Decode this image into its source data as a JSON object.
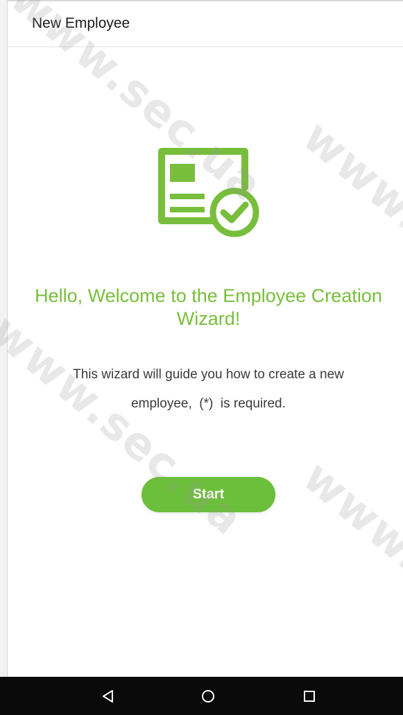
{
  "header": {
    "title": "New Employee"
  },
  "welcome": {
    "heading": "Hello, Welcome to the Employee Creation Wizard!",
    "description": "This wizard will guide you how to create a new employee,  (*)  is required."
  },
  "actions": {
    "start_label": "Start"
  },
  "navigation": {
    "buttons": [
      "back-icon",
      "home-icon",
      "recent-apps-icon"
    ]
  },
  "watermark": {
    "text": "www.sec.ua"
  },
  "colors": {
    "accent": "#78be3c",
    "button": "#6cbf3a",
    "nav_bar": "#0a0a0a"
  }
}
